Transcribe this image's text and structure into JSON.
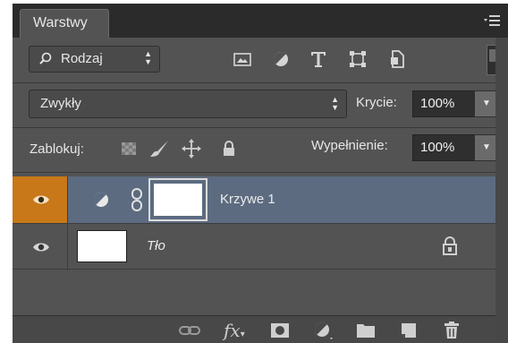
{
  "panel": {
    "tab_label": "Warstwy",
    "menu_icon": "panel-menu-icon"
  },
  "filter": {
    "kind_label": "Rodzaj",
    "icons": [
      "filter-pixel-icon",
      "filter-adjustment-icon",
      "filter-type-icon",
      "filter-shape-icon",
      "filter-smart-object-icon"
    ]
  },
  "blend": {
    "mode": "Zwykły",
    "opacity_label": "Krycie:",
    "opacity_value": "100%"
  },
  "lock": {
    "label": "Zablokuj:",
    "icons": [
      "lock-transparent-pixels-icon",
      "lock-image-pixels-icon",
      "lock-position-icon",
      "lock-all-icon"
    ],
    "fill_label": "Wypełnienie:",
    "fill_value": "100%"
  },
  "layers": [
    {
      "name": "Krzywe 1",
      "type": "adjustment-curves",
      "visible": true,
      "selected": true
    },
    {
      "name": "Tło",
      "type": "background",
      "visible": true,
      "selected": false,
      "locked": true
    }
  ],
  "footer": {
    "icons": [
      "link-layers-icon",
      "fx-icon",
      "add-mask-icon",
      "new-adjustment-icon",
      "new-group-icon",
      "new-layer-icon",
      "trash-icon"
    ],
    "fx_label": "fx"
  },
  "colors": {
    "panel_bg": "#535353",
    "header_bg": "#2b2b2b",
    "selected_row": "#5c6b80",
    "visibility_active": "#c87818"
  }
}
